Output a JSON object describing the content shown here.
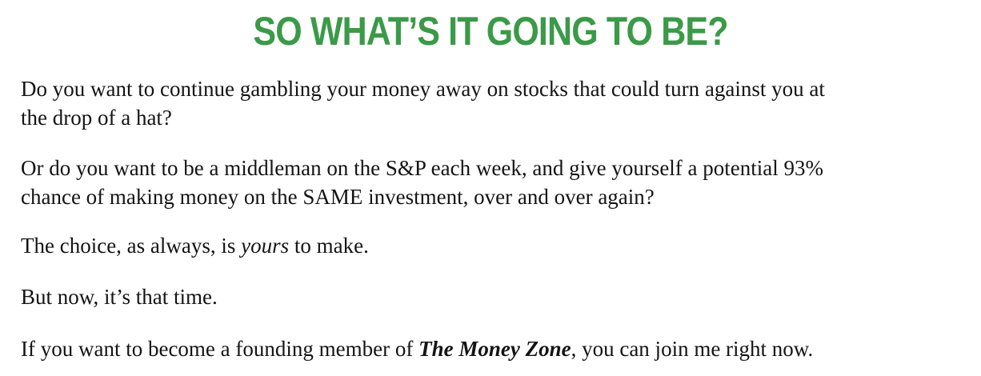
{
  "headline": "SO WHAT’S IT GOING TO BE?",
  "paragraphs": {
    "p1": {
      "line1": "Do you want to continue gambling your money away on stocks that could turn against you at",
      "line2": "the drop of a hat?"
    },
    "p2": {
      "line1": "Or do you want to be a middleman on the S&P each week, and give yourself a potential 93%",
      "line2": "chance of making money on the SAME investment, over and over again?"
    },
    "p3": {
      "before": "The choice, as always, is ",
      "emphasis": "yours",
      "after": " to make."
    },
    "p4": {
      "text": "But now, it’s that time."
    },
    "p5": {
      "before": "If you want to become a founding member of ",
      "brand": "The Money Zone",
      "after": ", you can join me right now."
    }
  },
  "colors": {
    "headline": "#3b9a48",
    "body": "#141414",
    "background": "#ffffff"
  }
}
